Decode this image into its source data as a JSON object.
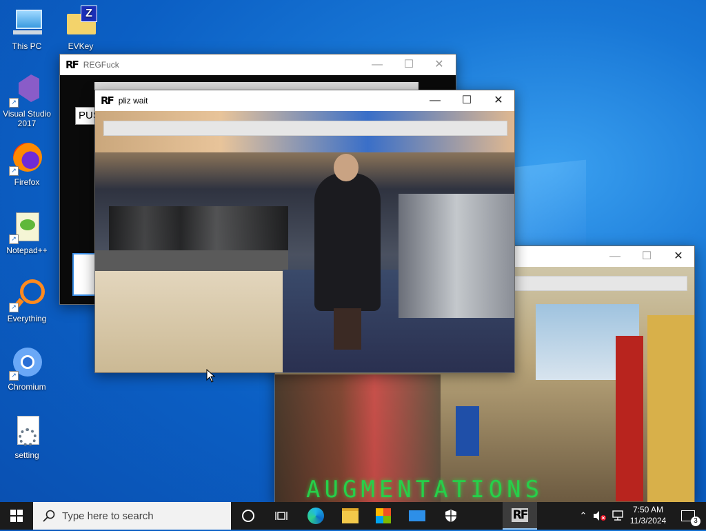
{
  "desktop": {
    "icons": [
      {
        "label": "This PC"
      },
      {
        "label": "EVKey"
      },
      {
        "label": "Visual Studio 2017"
      },
      {
        "label": "Firefox"
      },
      {
        "label": "Notepad++"
      },
      {
        "label": "Everything"
      },
      {
        "label": "Chromium"
      },
      {
        "label": "setting"
      }
    ]
  },
  "windows": {
    "back": {
      "title": "REGFuck",
      "logo": "RF",
      "partial_text": "PUS"
    },
    "front": {
      "title": "pliz wait",
      "logo": "RF"
    },
    "right": {
      "overlay_text": "AUGMENTATIONS ACTIVATED"
    }
  },
  "controls": {
    "minimize": "—",
    "maximize": "☐",
    "close": "✕"
  },
  "taskbar": {
    "search_placeholder": "Type here to search",
    "app_logo": "RF",
    "time": "7:50 AM",
    "date": "11/3/2024",
    "notification_count": "3"
  },
  "colors": {
    "accent": "#0078d7",
    "taskbar": "#1b1b1b",
    "overlay_text": "#26d04a"
  }
}
